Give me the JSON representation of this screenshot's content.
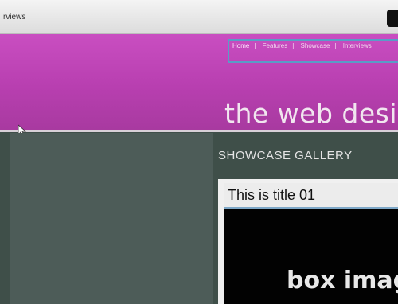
{
  "toolbar": {
    "title": "rviews"
  },
  "nav": {
    "items": [
      "Home",
      "Features",
      "Showcase",
      "Interviews"
    ]
  },
  "header": {
    "site_title": "the web desig"
  },
  "showcase": {
    "section_title": "SHOWCASE GALLERY",
    "card": {
      "title": "This is title 01",
      "image_label": "box imag"
    }
  },
  "colors": {
    "header_magenta": "#c94ec1",
    "page_background": "#3f4f49",
    "nav_border": "#5a9cc7"
  }
}
